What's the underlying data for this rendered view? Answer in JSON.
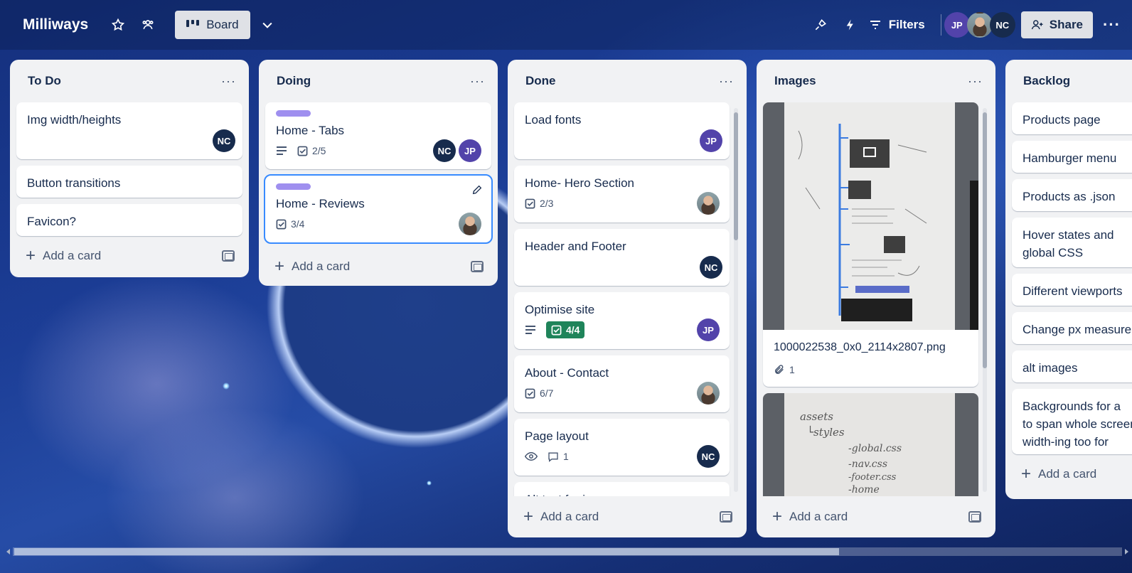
{
  "header": {
    "board_name": "Milliways",
    "view_label": "Board",
    "filters_label": "Filters",
    "share_label": "Share",
    "members": [
      {
        "initials": "JP",
        "kind": "jp"
      },
      {
        "initials": "",
        "kind": "photo"
      },
      {
        "initials": "NC",
        "kind": "nc"
      }
    ]
  },
  "lists": {
    "todo": {
      "title": "To Do",
      "add_label": "Add a card",
      "cards": [
        {
          "title": "Img width/heights",
          "member": "NC"
        },
        {
          "title": "Button transitions"
        },
        {
          "title": "Favicon?"
        }
      ]
    },
    "doing": {
      "title": "Doing",
      "add_label": "Add a card",
      "cards": [
        {
          "title": "Home - Tabs",
          "checklist": "2/5",
          "members": [
            "NC",
            "JP"
          ]
        },
        {
          "title": "Home - Reviews",
          "checklist": "3/4"
        }
      ]
    },
    "done": {
      "title": "Done",
      "add_label": "Add a card",
      "cards": [
        {
          "title": "Load fonts",
          "member": "JP"
        },
        {
          "title": "Home- Hero Section",
          "checklist": "2/3"
        },
        {
          "title": "Header and Footer",
          "member": "NC"
        },
        {
          "title": "Optimise site",
          "checklist": "4/4",
          "member": "JP"
        },
        {
          "title": "About - Contact",
          "checklist": "6/7"
        },
        {
          "title": "Page layout",
          "comments": "1",
          "member": "NC"
        },
        {
          "title": "Alt text for images"
        }
      ]
    },
    "images": {
      "title": "Images",
      "add_label": "Add a card",
      "cards": [
        {
          "title": "1000022538_0x0_2114x2807.png",
          "attachments": "1"
        },
        {
          "sketch_lines": [
            "assets",
            "└styles",
            "-global.css",
            "-nav.css",
            "-footer.css",
            "-home"
          ]
        }
      ]
    },
    "backlog": {
      "title": "Backlog",
      "add_label": "Add a card",
      "cards": [
        {
          "title": "Products page"
        },
        {
          "title": "Hamburger menu"
        },
        {
          "title": "Products as .json"
        },
        {
          "title_l1": "Hover states and",
          "title_l2": "global CSS"
        },
        {
          "title": "Different viewports"
        },
        {
          "title": "Change px measurements"
        },
        {
          "title": "alt images"
        },
        {
          "title_l1": "Backgrounds for a",
          "title_l2": "to span whole screen",
          "title_l3": "width-ing too for"
        }
      ]
    }
  }
}
